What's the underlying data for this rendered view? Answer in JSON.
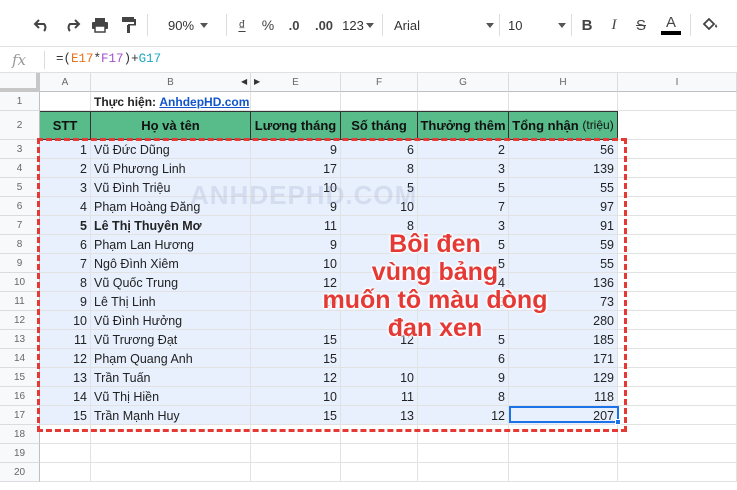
{
  "toolbar": {
    "zoom": "90%",
    "currency": "₫",
    "percent": "%",
    "dec_decrease": ".0",
    "dec_increase": ".00",
    "more_formats": "123",
    "font": "Arial",
    "font_size": "10",
    "bold": "B",
    "italic": "I",
    "strike": "S",
    "text_color": "A"
  },
  "formula_bar": {
    "fx": "fx",
    "prefix": "=(",
    "ref1": "E17",
    "op1": "*",
    "ref2": "F17",
    "op2": ")+",
    "ref3": "G17"
  },
  "columns": [
    "A",
    "B",
    "E",
    "F",
    "G",
    "H",
    "I"
  ],
  "rows": [
    "1",
    "2",
    "3",
    "4",
    "5",
    "6",
    "7",
    "8",
    "9",
    "10",
    "11",
    "12",
    "13",
    "14",
    "15",
    "16",
    "17",
    "18",
    "19",
    "20"
  ],
  "credit": {
    "label": "Thực hiện:",
    "link": "AnhdepHD.com"
  },
  "headers": {
    "stt": "STT",
    "name": "Họ và tên",
    "salary": "Lương tháng",
    "months": "Số tháng",
    "bonus": "Thưởng thêm",
    "total": "Tổng nhận",
    "total_unit": "(triệu)"
  },
  "table": [
    {
      "stt": "1",
      "name": "Vũ Đức Dũng",
      "salary": "9",
      "months": "6",
      "bonus": "2",
      "total": "56"
    },
    {
      "stt": "2",
      "name": "Vũ Phương Linh",
      "salary": "17",
      "months": "8",
      "bonus": "3",
      "total": "139"
    },
    {
      "stt": "3",
      "name": "Vũ Đình Triệu",
      "salary": "10",
      "months": "5",
      "bonus": "5",
      "total": "55"
    },
    {
      "stt": "4",
      "name": "Phạm Hoàng Đăng",
      "salary": "9",
      "months": "10",
      "bonus": "7",
      "total": "97"
    },
    {
      "stt": "5",
      "name": "Lê Thị Thuyên Mơ",
      "salary": "11",
      "months": "8",
      "bonus": "3",
      "total": "91"
    },
    {
      "stt": "6",
      "name": "Phạm Lan Hương",
      "salary": "9",
      "months": "",
      "bonus": "5",
      "total": "59"
    },
    {
      "stt": "7",
      "name": "Ngô Đình Xiêm",
      "salary": "10",
      "months": "",
      "bonus": "5",
      "total": "55"
    },
    {
      "stt": "8",
      "name": "Vũ Quốc Trung",
      "salary": "12",
      "months": "",
      "bonus": "4",
      "total": "136"
    },
    {
      "stt": "9",
      "name": "Lê Thị Linh",
      "salary": "10",
      "months": "",
      "bonus": "3",
      "total": "73"
    },
    {
      "stt": "10",
      "name": "Vũ Đình Hưởng",
      "salary": "",
      "months": "",
      "bonus": "",
      "total": "280"
    },
    {
      "stt": "11",
      "name": "Vũ Trương Đạt",
      "salary": "15",
      "months": "12",
      "bonus": "5",
      "total": "185"
    },
    {
      "stt": "12",
      "name": "Phạm Quang Anh",
      "salary": "15",
      "months": "",
      "bonus": "6",
      "total": "171"
    },
    {
      "stt": "13",
      "name": "Trần Tuấn",
      "salary": "12",
      "months": "10",
      "bonus": "9",
      "total": "129"
    },
    {
      "stt": "14",
      "name": "Vũ Thị Hiền",
      "salary": "10",
      "months": "11",
      "bonus": "8",
      "total": "118"
    },
    {
      "stt": "15",
      "name": "Trần Mạnh Huy",
      "salary": "15",
      "months": "13",
      "bonus": "12",
      "total": "207"
    }
  ],
  "annotation": [
    "Bôi đen",
    "vùng bảng",
    "muốn tô màu dòng",
    "đan xen"
  ],
  "watermark": "ANHDEPHD.COM",
  "colors": {
    "header_green": "#57bb8a",
    "selection": "#e8f0fe",
    "accent_red": "#e53935",
    "active_blue": "#1a73e8"
  }
}
